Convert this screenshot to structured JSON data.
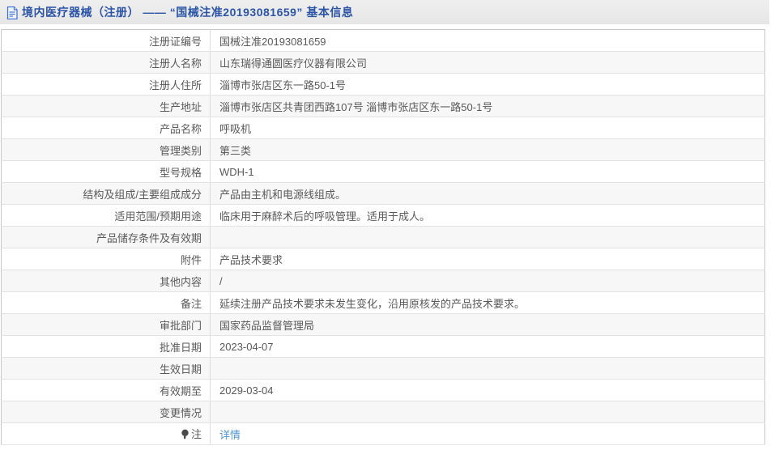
{
  "header": {
    "icon": "document-icon",
    "title": "境内医疗器械（注册） —— “国械注准20193081659” 基本信息"
  },
  "colors": {
    "title_blue": "#2b54a7",
    "link_blue": "#4f94d6",
    "header_bar_gray": "#e9e9e9",
    "row_stripe_gray": "#f7f7f7"
  },
  "table": {
    "rows": [
      {
        "label": "注册证编号",
        "value": "国械注准20193081659"
      },
      {
        "label": "注册人名称",
        "value": "山东瑞得通圆医疗仪器有限公司"
      },
      {
        "label": "注册人住所",
        "value": "淄博市张店区东一路50-1号"
      },
      {
        "label": "生产地址",
        "value": "淄博市张店区共青团西路107号 淄博市张店区东一路50-1号"
      },
      {
        "label": "产品名称",
        "value": "呼吸机"
      },
      {
        "label": "管理类别",
        "value": "第三类"
      },
      {
        "label": "型号规格",
        "value": "WDH-1"
      },
      {
        "label": "结构及组成/主要组成成分",
        "value": "产品由主机和电源线组成。"
      },
      {
        "label": "适用范围/预期用途",
        "value": "临床用于麻醉术后的呼吸管理。适用于成人。"
      },
      {
        "label": "产品储存条件及有效期",
        "value": ""
      },
      {
        "label": "附件",
        "value": "产品技术要求"
      },
      {
        "label": "其他内容",
        "value": "/"
      },
      {
        "label": "备注",
        "value": "延续注册产品技术要求未发生变化，沿用原核发的产品技术要求。"
      },
      {
        "label": "审批部门",
        "value": "国家药品监督管理局"
      },
      {
        "label": "批准日期",
        "value": "2023-04-07"
      },
      {
        "label": "生效日期",
        "value": ""
      },
      {
        "label": "有效期至",
        "value": "2029-03-04"
      },
      {
        "label": "变更情况",
        "value": ""
      },
      {
        "label": "注",
        "value": "详情",
        "value_type": "link",
        "label_icon": "bulb-icon"
      }
    ]
  }
}
